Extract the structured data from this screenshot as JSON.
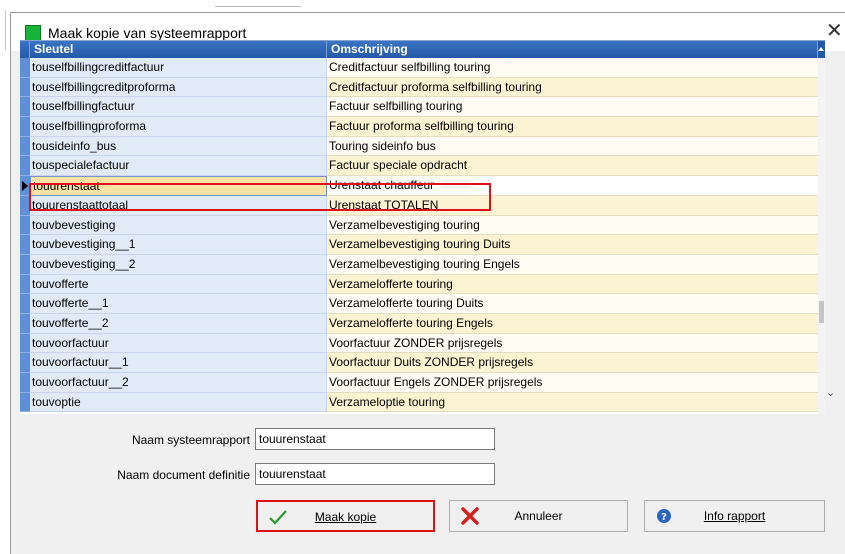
{
  "window": {
    "title": "Maak kopie van systeemrapport",
    "close_symbol": "✕"
  },
  "grid": {
    "columns": [
      "Sleutel",
      "Omschrijving"
    ],
    "selected_index": 6,
    "rows": [
      {
        "key": "touselfbillingcreditfactuur",
        "desc": "Creditfactuur selfbilling touring"
      },
      {
        "key": "touselfbillingcreditproforma",
        "desc": "Creditfactuur proforma selfbilling touring"
      },
      {
        "key": "touselfbillingfactuur",
        "desc": "Factuur selfbilling touring"
      },
      {
        "key": "touselfbillingproforma",
        "desc": "Factuur proforma selfbilling touring"
      },
      {
        "key": "tousideinfo_bus",
        "desc": "Touring sideinfo bus"
      },
      {
        "key": "touspecialefactuur",
        "desc": "Factuur speciale opdracht"
      },
      {
        "key": "touurenstaat",
        "desc": "Urenstaat chauffeur"
      },
      {
        "key": "touurenstaattotaal",
        "desc": "Urenstaat TOTALEN"
      },
      {
        "key": "touvbevestiging",
        "desc": "Verzamelbevestiging touring"
      },
      {
        "key": "touvbevestiging__1",
        "desc": "Verzamelbevestiging touring Duits"
      },
      {
        "key": "touvbevestiging__2",
        "desc": "Verzamelbevestiging touring Engels"
      },
      {
        "key": "touvofferte",
        "desc": "Verzamelofferte touring"
      },
      {
        "key": "touvofferte__1",
        "desc": "Verzamelofferte touring Duits"
      },
      {
        "key": "touvofferte__2",
        "desc": "Verzamelofferte touring Engels"
      },
      {
        "key": "touvoorfactuur",
        "desc": "Voorfactuur ZONDER prijsregels"
      },
      {
        "key": "touvoorfactuur__1",
        "desc": "Voorfactuur Duits ZONDER prijsregels"
      },
      {
        "key": "touvoorfactuur__2",
        "desc": "Voorfactuur Engels ZONDER prijsregels"
      },
      {
        "key": "touvoptie",
        "desc": "Verzameloptie touring"
      }
    ]
  },
  "form": {
    "naam_systeemrapport_label": "Naam systeemrapport",
    "naam_systeemrapport_value": "touurenstaat",
    "naam_document_label": "Naam document definitie",
    "naam_document_value": "touurenstaat"
  },
  "buttons": {
    "copy": {
      "label": "Maak kopie",
      "icon": "checkmark-icon"
    },
    "cancel": {
      "label": "Annuleer",
      "icon": "red-x-icon"
    },
    "info": {
      "label": "Info rapport",
      "icon": "help-icon"
    }
  },
  "colors": {
    "highlight_red": "#e0101a",
    "header_blue": "#2459a8",
    "app_icon_green": "#19b33a"
  }
}
